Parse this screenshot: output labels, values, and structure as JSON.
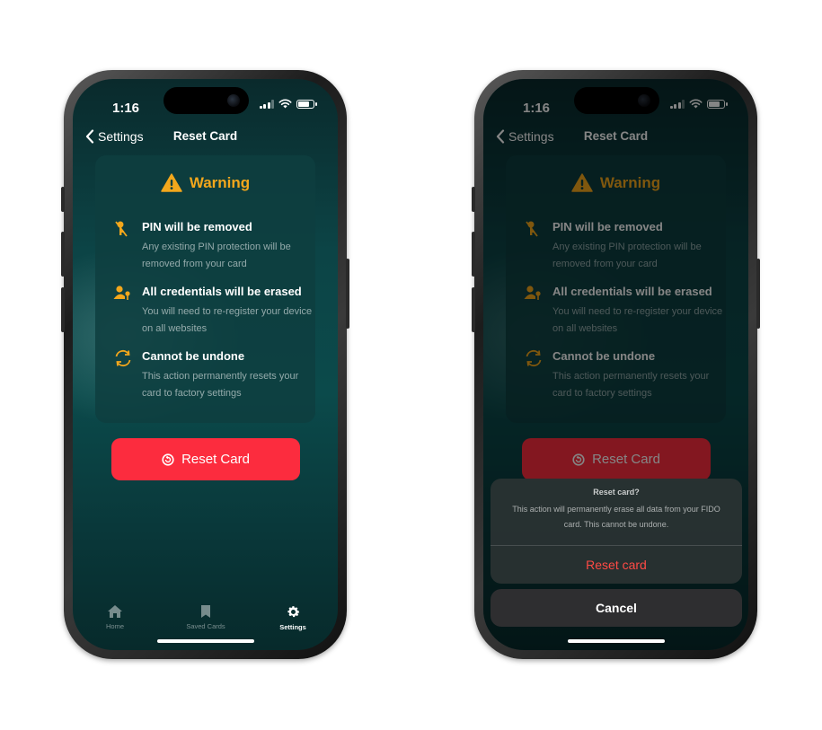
{
  "status": {
    "time": "1:16"
  },
  "nav": {
    "back_label": "Settings",
    "title": "Reset Card"
  },
  "warning": {
    "title": "Warning",
    "items": [
      {
        "icon": "key-off-icon",
        "title": "PIN will be removed",
        "desc": "Any existing PIN protection will be removed from your card"
      },
      {
        "icon": "user-key-icon",
        "title": "All credentials will be erased",
        "desc": "You will need to re-register your device on all websites"
      },
      {
        "icon": "refresh-icon",
        "title": "Cannot be undone",
        "desc": "This action permanently resets your card to factory settings"
      }
    ]
  },
  "reset_button": {
    "label": "Reset Card"
  },
  "tabs": [
    {
      "label": "Home",
      "icon": "home-icon"
    },
    {
      "label": "Saved Cards",
      "icon": "bookmark-icon"
    },
    {
      "label": "Settings",
      "icon": "gear-icon"
    }
  ],
  "alert": {
    "title": "Reset card?",
    "message": "This action will permanently erase all data from your FIDO card. This cannot be undone.",
    "confirm_label": "Reset card",
    "cancel_label": "Cancel"
  },
  "colors": {
    "accent_warning": "#f3a71c",
    "destructive": "#fc2c3e",
    "background": "#0b4a4b"
  }
}
